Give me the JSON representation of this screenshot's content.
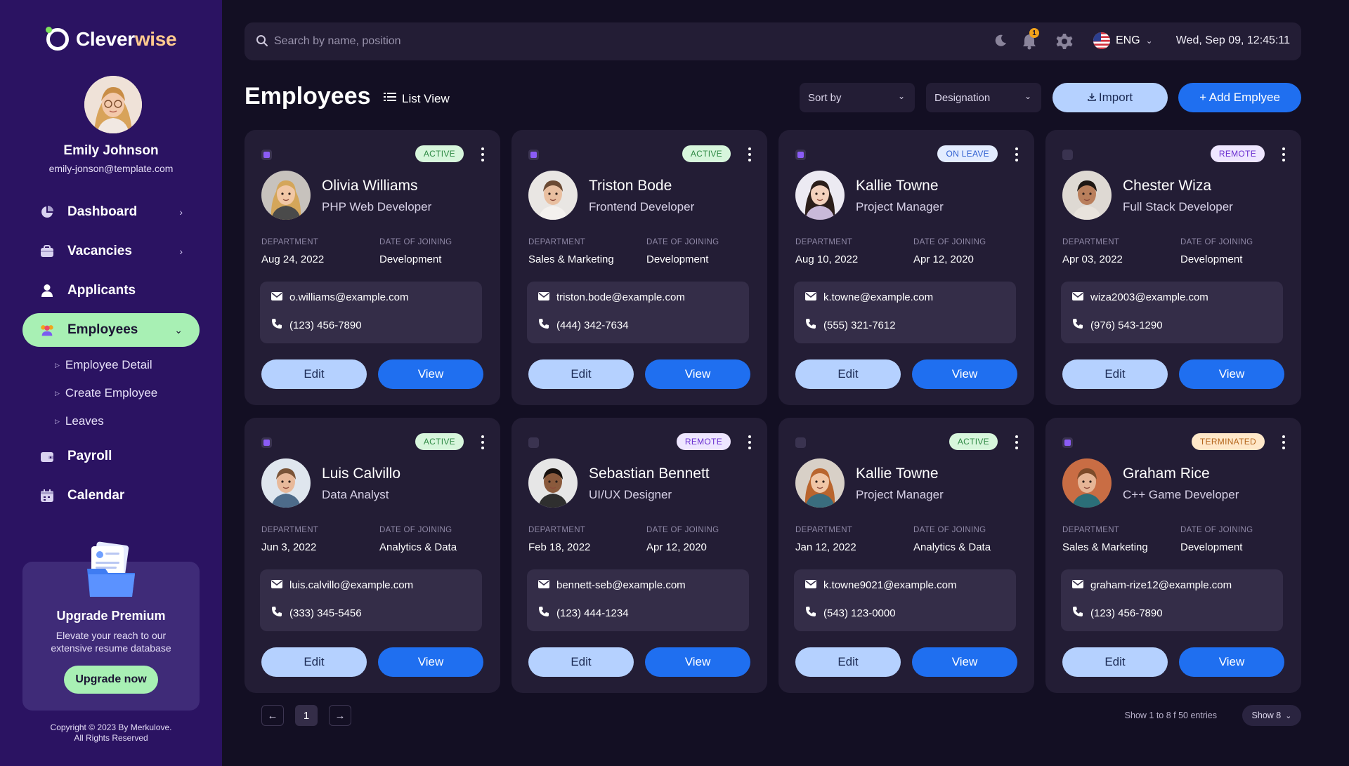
{
  "app": {
    "name_part1": "Clever",
    "name_part2": "wise"
  },
  "profile": {
    "name": "Emily Johnson",
    "email": "emily-jonson@template.com"
  },
  "nav": {
    "dashboard": "Dashboard",
    "vacancies": "Vacancies",
    "applicants": "Applicants",
    "employees": "Employees",
    "sub": [
      "Employee Detail",
      "Create Employee",
      "Leaves"
    ],
    "payroll": "Payroll",
    "calendar": "Calendar"
  },
  "upgrade": {
    "title": "Upgrade Premium",
    "desc_line1": "Elevate your reach to our",
    "desc_line2": "extensive resume database",
    "button": "Upgrade now"
  },
  "copyright": {
    "line1": "Copyright © 2023 By Merkulove.",
    "line2": "All Rights Reserved"
  },
  "topbar": {
    "search_placeholder": "Search by name, position",
    "notification_count": "1",
    "language": "ENG",
    "datetime": "Wed, Sep 09, 12:45:11"
  },
  "header": {
    "title": "Employees",
    "list_view": "List View",
    "sort_by": "Sort by",
    "designation": "Designation",
    "import": "Import",
    "add": "+ Add Emplyee"
  },
  "labels": {
    "department": "DEPARTMENT",
    "date_of_joining": "DATE OF JOINING",
    "edit": "Edit",
    "view": "View"
  },
  "employees": [
    {
      "name": "Olivia Williams",
      "role": "PHP Web Developer",
      "status": "ACTIVE",
      "department": "Aug 24, 2022",
      "date_of_joining": "Development",
      "email": "o.williams@example.com",
      "phone": "(123) 456-7890",
      "checked": true
    },
    {
      "name": "Triston Bode",
      "role": "Frontend Developer",
      "status": "ACTIVE",
      "department": "Sales & Marketing",
      "date_of_joining": "Development",
      "email": "triston.bode@example.com",
      "phone": "(444) 342-7634",
      "checked": true
    },
    {
      "name": "Kallie Towne",
      "role": "Project Manager",
      "status": "ON LEAVE",
      "department": "Aug 10, 2022",
      "date_of_joining": "Apr 12, 2020",
      "email": "k.towne@example.com",
      "phone": "(555) 321-7612",
      "checked": true
    },
    {
      "name": "Chester Wiza",
      "role": "Full Stack Developer",
      "status": "REMOTE",
      "department": "Apr 03, 2022",
      "date_of_joining": "Development",
      "email": "wiza2003@example.com",
      "phone": "(976) 543-1290",
      "checked": false
    },
    {
      "name": "Luis Calvillo",
      "role": "Data Analyst",
      "status": "ACTIVE",
      "department": "Jun 3, 2022",
      "date_of_joining": "Analytics & Data",
      "email": "luis.calvillo@example.com",
      "phone": "(333) 345-5456",
      "checked": true
    },
    {
      "name": "Sebastian Bennett",
      "role": "UI/UX Designer",
      "status": "REMOTE",
      "department": "Feb 18, 2022",
      "date_of_joining": "Apr 12, 2020",
      "email": "bennett-seb@example.com",
      "phone": "(123) 444-1234",
      "checked": false
    },
    {
      "name": "Kallie Towne",
      "role": "Project Manager",
      "status": "ACTIVE",
      "department": "Jan 12, 2022",
      "date_of_joining": "Analytics & Data",
      "email": "k.towne9021@example.com",
      "phone": "(543) 123-0000",
      "checked": false
    },
    {
      "name": "Graham Rice",
      "role": "C++ Game Developer",
      "status": "TERMINATED",
      "department": "Sales & Marketing",
      "date_of_joining": "Development",
      "email": "graham-rize12@example.com",
      "phone": "(123) 456-7890",
      "checked": true
    }
  ],
  "pagination": {
    "current_page": "1",
    "entries_text": "Show 1 to 8 f 50 entries",
    "show": "Show 8"
  },
  "colors": {
    "sidebar": "#2b1362",
    "background": "#130f23",
    "card": "#231d35",
    "accent_green": "#a8f0b4",
    "primary_blue": "#1f6ff0",
    "light_blue": "#b5d1ff"
  }
}
